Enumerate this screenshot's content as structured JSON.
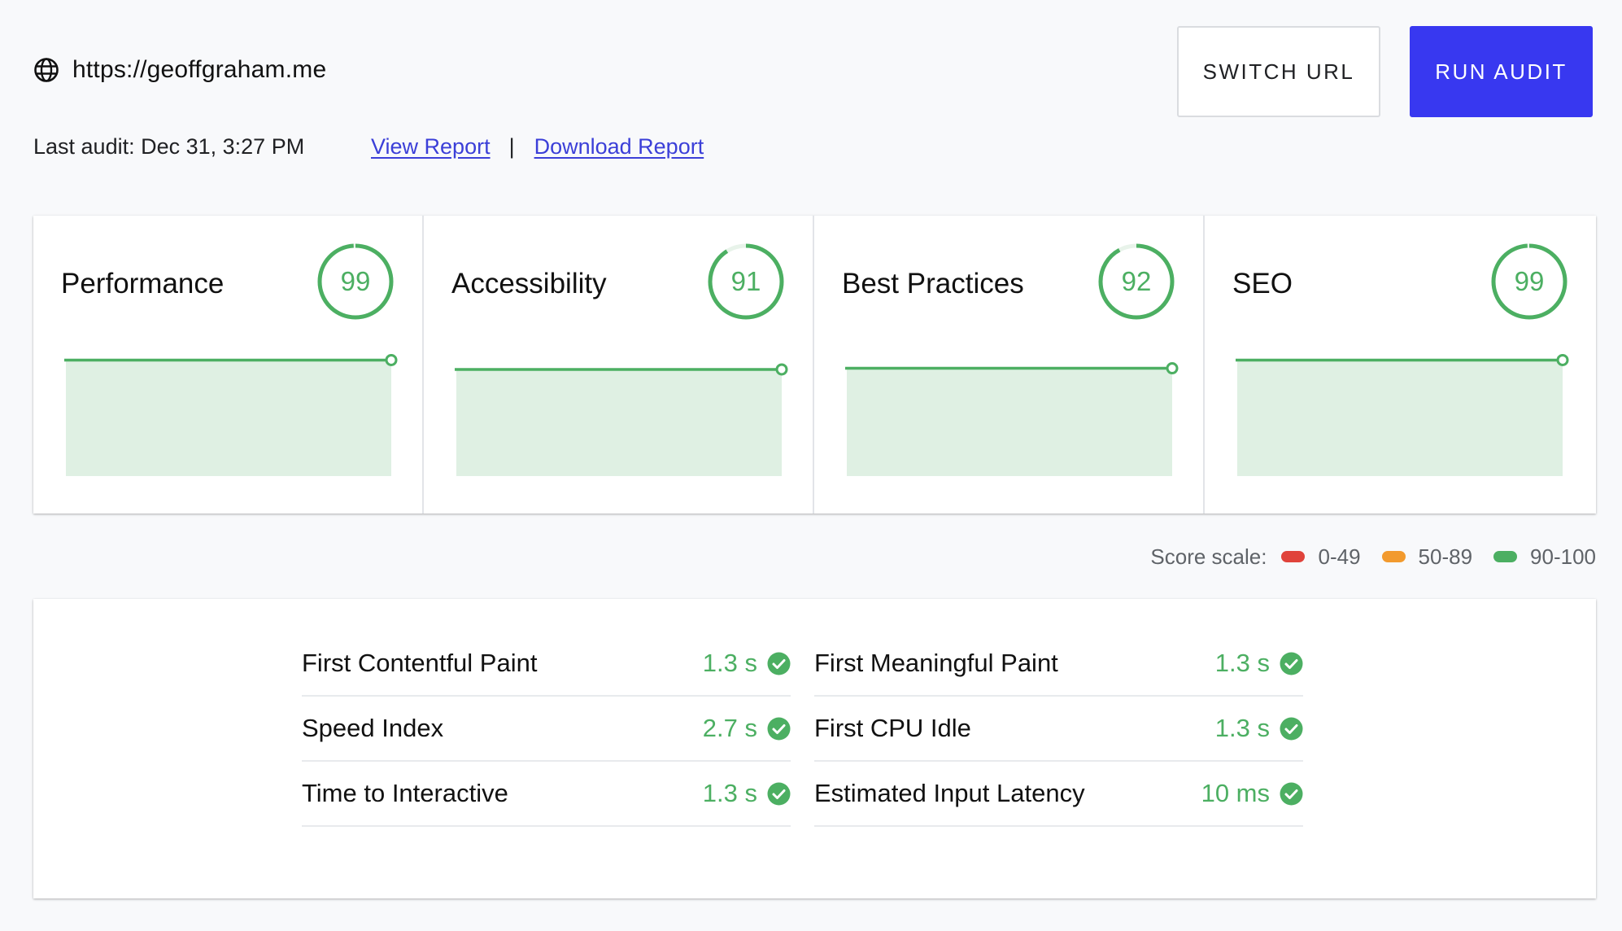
{
  "site": {
    "icon": "globe-icon",
    "url": "https://geoffgraham.me"
  },
  "audit": {
    "last_audit": "Last audit: Dec 31, 3:27 PM",
    "view_report": "View Report",
    "separator": "|",
    "download_report": "Download Report"
  },
  "buttons": {
    "switch_url": "SWITCH URL",
    "run_audit": "RUN AUDIT"
  },
  "colors": {
    "good": "#4caf62",
    "average": "#f29a2e",
    "poor": "#e0433b",
    "trend_fill": "#dff0e3",
    "primary": "#3838f0"
  },
  "scores": [
    {
      "name": "Performance",
      "score": "99",
      "value": 99,
      "trend_level": 0.99
    },
    {
      "name": "Accessibility",
      "score": "91",
      "value": 91,
      "trend_level": 0.91
    },
    {
      "name": "Best Practices",
      "score": "92",
      "value": 92,
      "trend_level": 0.92
    },
    {
      "name": "SEO",
      "score": "99",
      "value": 99,
      "trend_level": 0.99
    }
  ],
  "score_scale": {
    "label": "Score scale:",
    "ranges": [
      {
        "range": "0-49",
        "color": "#e0433b"
      },
      {
        "range": "50-89",
        "color": "#f29a2e"
      },
      {
        "range": "90-100",
        "color": "#4caf62"
      }
    ]
  },
  "metrics": {
    "left": [
      {
        "name": "First Contentful Paint",
        "value": "1.3 s",
        "status": "pass"
      },
      {
        "name": "Speed Index",
        "value": "2.7 s",
        "status": "pass"
      },
      {
        "name": "Time to Interactive",
        "value": "1.3 s",
        "status": "pass"
      }
    ],
    "right": [
      {
        "name": "First Meaningful Paint",
        "value": "1.3 s",
        "status": "pass"
      },
      {
        "name": "First CPU Idle",
        "value": "1.3 s",
        "status": "pass"
      },
      {
        "name": "Estimated Input Latency",
        "value": "10 ms",
        "status": "pass"
      }
    ]
  }
}
